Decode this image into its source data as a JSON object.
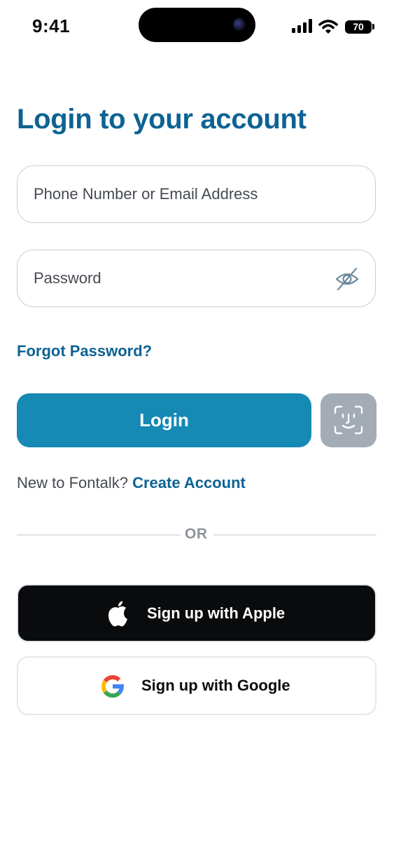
{
  "status_bar": {
    "time": "9:41",
    "battery": "70"
  },
  "login": {
    "title": "Login to your account",
    "identifier_placeholder": "Phone Number or Email Address",
    "password_placeholder": "Password",
    "forgot_label": "Forgot Password?",
    "login_label": "Login"
  },
  "signup_prompt": {
    "text": "New to Fontalk?",
    "link": "Create Account"
  },
  "divider": {
    "label": "OR"
  },
  "social": {
    "apple_label": "Sign up with Apple",
    "google_label": "Sign up with Google"
  },
  "icons": {
    "signal": "cellular-signal-icon",
    "wifi": "wifi-icon",
    "battery": "battery-icon",
    "password_toggle": "eye-off-icon",
    "biometric": "face-id-icon",
    "apple": "apple-logo-icon",
    "google": "google-logo-icon"
  },
  "colors": {
    "brand": "#0d6393",
    "primary_button": "#1689b5",
    "faceid_button": "#a3abb5",
    "apple_button": "#0a0b0d"
  }
}
